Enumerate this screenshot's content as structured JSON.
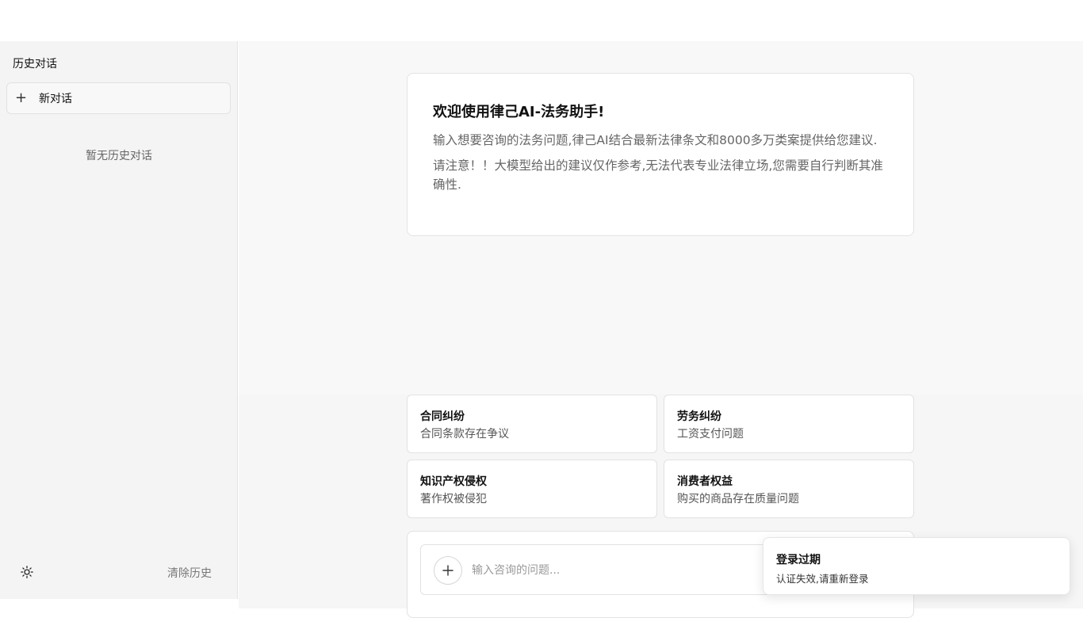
{
  "sidebar": {
    "title": "历史对话",
    "new_chat_label": "新对话",
    "empty_text": "暂无历史对话",
    "clear_history_label": "清除历史",
    "theme_icon": "sun-icon"
  },
  "welcome": {
    "title": "欢迎使用律己AI-法务助手!",
    "intro": "输入想要咨询的法务问题,律己AI结合最新法律条文和8000多万类案提供给您建议.",
    "warning": "请注意！！大模型给出的建议仅作参考,无法代表专业法律立场,您需要自行判断其准确性."
  },
  "topics": [
    {
      "title": "合同纠纷",
      "desc": "合同条款存在争议"
    },
    {
      "title": "劳务纠纷",
      "desc": "工资支付问题"
    },
    {
      "title": "知识产权侵权",
      "desc": "著作权被侵犯"
    },
    {
      "title": "消费者权益",
      "desc": "购买的商品存在质量问题"
    }
  ],
  "input": {
    "placeholder": "输入咨询的问题...",
    "attach_icon": "plus-icon"
  },
  "toast": {
    "title": "登录过期",
    "message": "认证失效,请重新登录"
  }
}
